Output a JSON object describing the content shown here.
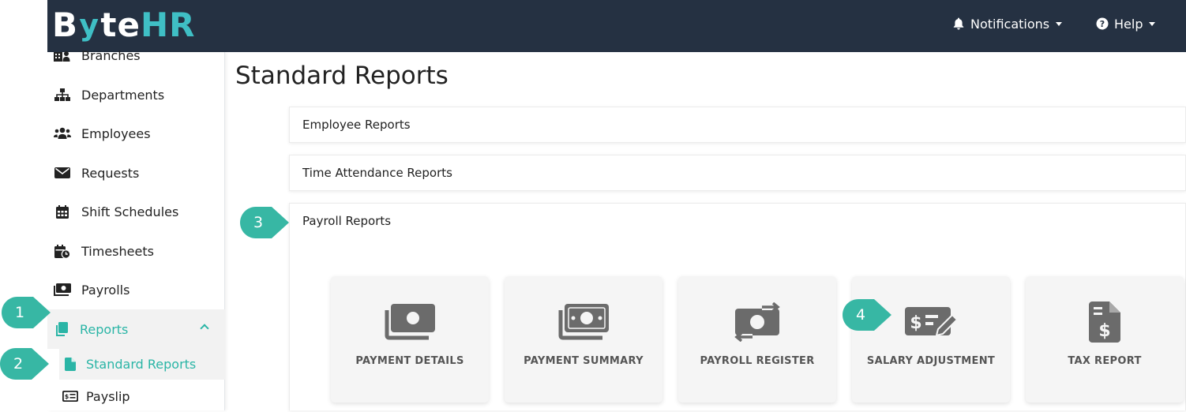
{
  "app": {
    "logo": {
      "part1": "B",
      "part2": "y",
      "part3": "te",
      "part4": "HR"
    },
    "brand_color": "#3fbfc5",
    "topbar_color": "#253142"
  },
  "topnav": {
    "notifications_label": "Notifications",
    "help_label": "Help"
  },
  "sidebar": {
    "items": [
      {
        "label": "Branches",
        "icon": "building-icon"
      },
      {
        "label": "Departments",
        "icon": "sitemap-icon"
      },
      {
        "label": "Employees",
        "icon": "users-icon"
      },
      {
        "label": "Requests",
        "icon": "envelope-icon"
      },
      {
        "label": "Shift Schedules",
        "icon": "calendar-icon"
      },
      {
        "label": "Timesheets",
        "icon": "calendar-clock-icon"
      },
      {
        "label": "Payrolls",
        "icon": "money-icon"
      },
      {
        "label": "Reports",
        "icon": "copy-icon"
      },
      {
        "label": "Standard Reports",
        "icon": "file-icon"
      },
      {
        "label": "Payslip",
        "icon": "money-check-icon"
      }
    ],
    "active_color": "#2ab5a6"
  },
  "main": {
    "title": "Standard Reports",
    "sections": [
      {
        "label": "Employee Reports"
      },
      {
        "label": "Time Attendance Reports"
      },
      {
        "label": "Payroll Reports"
      }
    ],
    "payroll_cards": [
      {
        "label": "PAYMENT DETAILS",
        "icon": "money-bill-icon"
      },
      {
        "label": "PAYMENT SUMMARY",
        "icon": "money-bills-icon"
      },
      {
        "label": "PAYROLL REGISTER",
        "icon": "money-transfer-icon"
      },
      {
        "label": "SALARY ADJUSTMENT",
        "icon": "money-check-edit-icon"
      },
      {
        "label": "TAX REPORT",
        "icon": "file-invoice-dollar-icon"
      }
    ]
  },
  "callouts": [
    {
      "number": "1"
    },
    {
      "number": "2"
    },
    {
      "number": "3"
    },
    {
      "number": "4"
    }
  ]
}
